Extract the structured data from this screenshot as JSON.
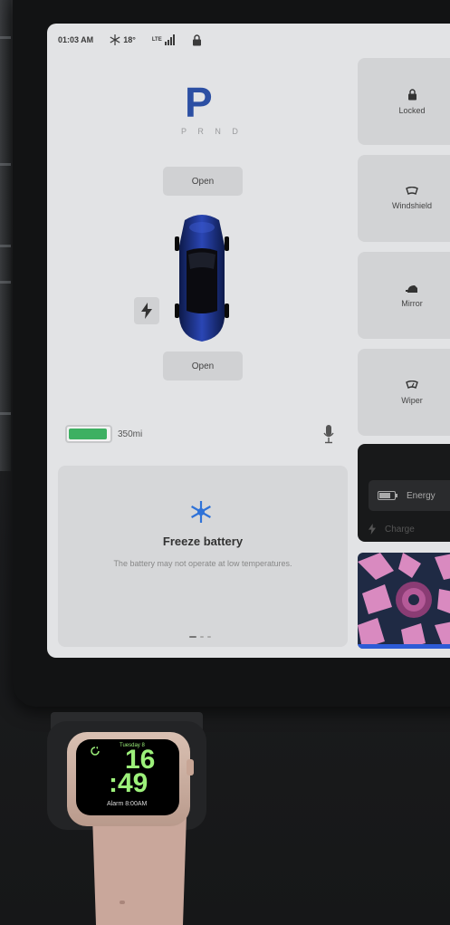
{
  "status": {
    "time": "01:03 AM",
    "temperature": "18°",
    "signal_label": "LTE"
  },
  "drive": {
    "gear": "P",
    "gear_row": "P R N D"
  },
  "car": {
    "frunk_label": "Open",
    "trunk_label": "Open",
    "battery_range": "350mi",
    "battery_level": 0.95
  },
  "alert": {
    "title": "Freeze battery",
    "description": "The battery may not operate at low temperatures."
  },
  "quick_controls": [
    {
      "label": "Locked",
      "icon": "lock-icon"
    },
    {
      "label": "Windshield",
      "icon": "defrost-icon"
    },
    {
      "label": "Mirror",
      "icon": "mirror-icon"
    },
    {
      "label": "Wiper",
      "icon": "wiper-icon"
    }
  ],
  "menu": {
    "energy_label": "Energy",
    "charge_label": "Charge"
  },
  "watch": {
    "date": "Tuesday 8",
    "hour": "16",
    "minute": ":49",
    "alarm": "Alarm 8:00AM"
  },
  "colors": {
    "gear_blue": "#2c4fa3",
    "battery_green": "#3db062",
    "watch_green": "#9cf07a",
    "media_pink": "#d98ac0"
  }
}
